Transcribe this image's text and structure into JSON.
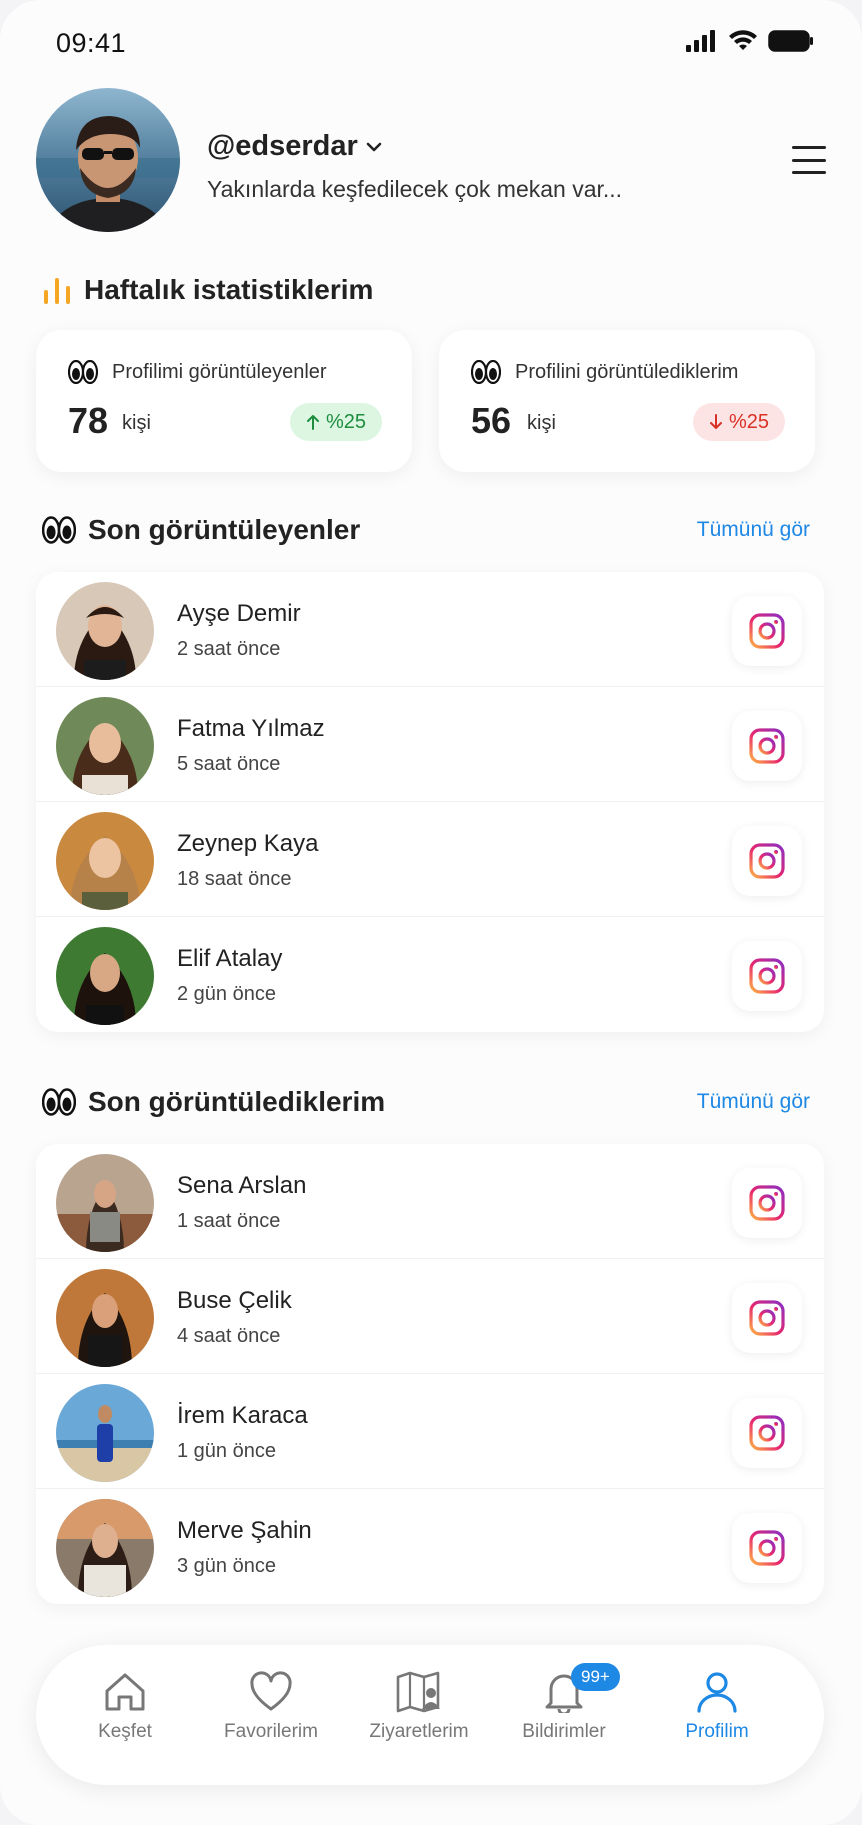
{
  "status_bar": {
    "time": "09:41"
  },
  "profile": {
    "username": "@edserdar",
    "bio": "Yakınlarda keşfedilecek çok mekan var..."
  },
  "weekly_stats": {
    "title": "Haftalık istatistiklerim",
    "viewers_card": {
      "label": "Profilimi görüntüleyenler",
      "value": "78",
      "unit": "kişi",
      "change": "%25",
      "trend": "up"
    },
    "viewed_card": {
      "label": "Profilini görüntülediklerim",
      "value": "56",
      "unit": "kişi",
      "change": "%25",
      "trend": "down"
    }
  },
  "recent_viewers": {
    "title": "Son görüntüleyenler",
    "see_all": "Tümünü gör",
    "items": [
      {
        "name": "Ayşe Demir",
        "time": "2 saat önce"
      },
      {
        "name": "Fatma Yılmaz",
        "time": "5 saat önce"
      },
      {
        "name": "Zeynep Kaya",
        "time": "18 saat önce"
      },
      {
        "name": "Elif Atalay",
        "time": "2 gün önce"
      }
    ]
  },
  "recent_viewed": {
    "title": "Son görüntülediklerim",
    "see_all": "Tümünü gör",
    "items": [
      {
        "name": "Sena Arslan",
        "time": "1 saat önce"
      },
      {
        "name": "Buse Çelik",
        "time": "4 saat önce"
      },
      {
        "name": "İrem Karaca",
        "time": "1 gün önce"
      },
      {
        "name": "Merve Şahin",
        "time": "3 gün önce"
      }
    ]
  },
  "bottom_nav": {
    "items": [
      {
        "label": "Keşfet",
        "icon": "home-icon"
      },
      {
        "label": "Favorilerim",
        "icon": "heart-icon"
      },
      {
        "label": "Ziyaretlerim",
        "icon": "map-person-icon"
      },
      {
        "label": "Bildirimler",
        "icon": "bell-icon",
        "badge": "99+"
      },
      {
        "label": "Profilim",
        "icon": "person-icon",
        "active": true
      }
    ]
  },
  "colors": {
    "accent": "#1e88e5",
    "up": "#1e8e3e",
    "down": "#d93025",
    "chart_icon": "#f5a623"
  }
}
